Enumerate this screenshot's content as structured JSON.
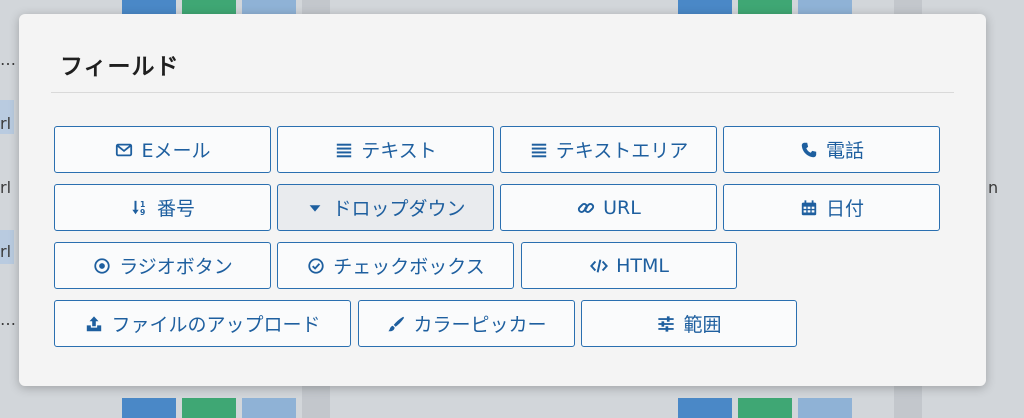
{
  "background": {
    "row_fragments": [
      "…",
      "rl",
      "rl",
      "rl",
      "…"
    ],
    "right_fragment": "n"
  },
  "modal": {
    "title": "フィールド",
    "fields": [
      {
        "label": "Eメール",
        "icon": "envelope-icon"
      },
      {
        "label": "テキスト",
        "icon": "align-justify-icon"
      },
      {
        "label": "テキストエリア",
        "icon": "align-justify-icon"
      },
      {
        "label": "電話",
        "icon": "phone-icon"
      },
      {
        "label": "番号",
        "icon": "sort-numeric-icon"
      },
      {
        "label": "ドロップダウン",
        "icon": "caret-down-icon",
        "selected": true
      },
      {
        "label": "URL",
        "icon": "link-icon"
      },
      {
        "label": "日付",
        "icon": "calendar-icon"
      },
      {
        "label": "ラジオボタン",
        "icon": "dot-circle-icon"
      },
      {
        "label": "チェックボックス",
        "icon": "check-circle-icon"
      },
      {
        "label": "HTML",
        "icon": "code-icon"
      },
      {
        "label": "ファイルのアップロード",
        "icon": "upload-icon"
      },
      {
        "label": "カラーピッカー",
        "icon": "paint-brush-icon"
      },
      {
        "label": "範囲",
        "icon": "sliders-icon"
      }
    ]
  },
  "colors": {
    "accent": "#2a6fb0",
    "accent_text": "#1e5f9f",
    "modal_bg": "#f4f4f4"
  }
}
